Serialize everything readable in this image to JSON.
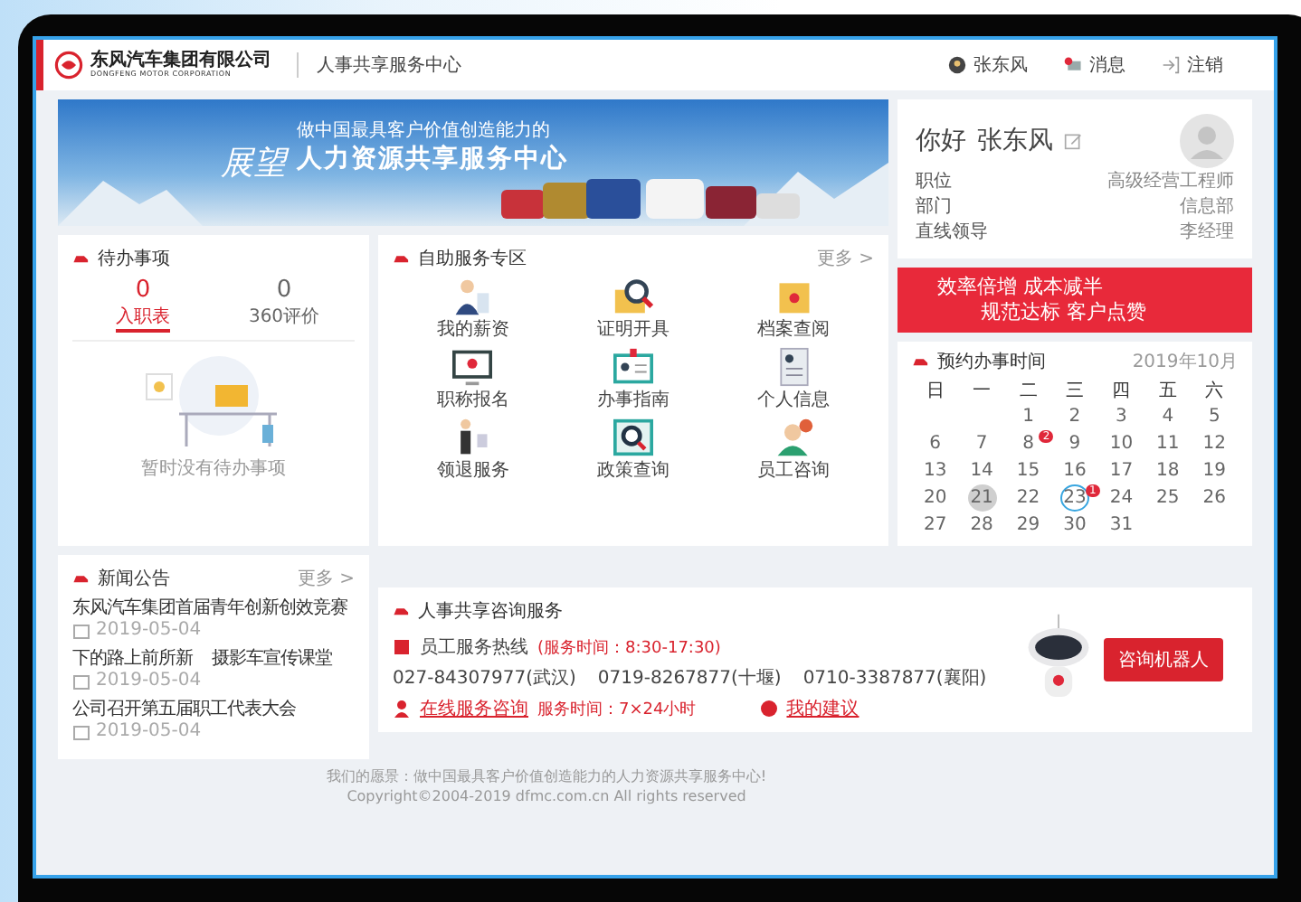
{
  "header": {
    "logo_name": "东风汽车集团有限公司",
    "logo_english": "DONGFENG MOTOR CORPORATION",
    "system_title": "人事共享服务中心",
    "user": "张东风",
    "messages": {
      "label": "消息",
      "unread": true
    },
    "logout": "注销"
  },
  "banner": {
    "calligraphy": "展望",
    "tagline": "做中国最具客户价值创造能力的",
    "title": "人力资源共享服务中心"
  },
  "todo": {
    "title": "待办事项",
    "tabs": [
      {
        "count": "0",
        "label": "入职表",
        "selected": true
      },
      {
        "count": "0",
        "label": "360评价",
        "selected": false
      }
    ],
    "empty_text": "暂时没有待办事项"
  },
  "services": {
    "title": "自助服务专区",
    "more": "更多 >",
    "items": [
      {
        "label": "我的薪资",
        "kind": "person-doc"
      },
      {
        "label": "证明开具",
        "kind": "folder-search"
      },
      {
        "label": "档案查阅",
        "kind": "folder"
      },
      {
        "label": "职称报名",
        "kind": "monitor"
      },
      {
        "label": "办事指南",
        "kind": "id-card"
      },
      {
        "label": "个人信息",
        "kind": "profile-doc"
      },
      {
        "label": "领退服务",
        "kind": "person-stand"
      },
      {
        "label": "政策查询",
        "kind": "window-search"
      },
      {
        "label": "员工咨询",
        "kind": "person-badge"
      }
    ]
  },
  "profile": {
    "greeting": "你好",
    "name": "张东风",
    "fields": [
      {
        "label": "职位",
        "value": "高级经营工程师"
      },
      {
        "label": "部门",
        "value": "信息部"
      },
      {
        "label": "直线领导",
        "value": "李经理"
      }
    ]
  },
  "promo": {
    "lines": [
      "效率倍增  成本减半",
      "规范达标  客户点赞"
    ]
  },
  "calendar": {
    "title": "预约办事时间",
    "month": "2019年10月",
    "weekdays": [
      "日",
      "一",
      "二",
      "三",
      "四",
      "五",
      "六"
    ],
    "weeks": [
      [
        {
          "day": "1",
          "selected": false,
          "circled": false
        },
        {
          "day": "2",
          "selected": false,
          "circled": false
        },
        {
          "day": "3",
          "selected": false,
          "circled": false
        },
        {
          "day": "4",
          "selected": false,
          "circled": false
        },
        {
          "day": "5",
          "selected": false,
          "circled": false
        }
      ],
      [
        {
          "day": "6",
          "selected": false,
          "circled": false
        },
        {
          "day": "7",
          "selected": false,
          "circled": false
        },
        {
          "day": "8",
          "selected": false,
          "circled": false,
          "badge": "2"
        },
        {
          "day": "9",
          "selected": false,
          "circled": false
        },
        {
          "day": "10",
          "selected": false,
          "circled": false
        },
        {
          "day": "11",
          "selected": false,
          "circled": false
        },
        {
          "day": "12",
          "selected": false,
          "circled": false
        }
      ],
      [
        {
          "day": "13",
          "selected": false,
          "circled": false
        },
        {
          "day": "14",
          "selected": false,
          "circled": false
        },
        {
          "day": "15",
          "selected": false,
          "circled": false
        },
        {
          "day": "16",
          "selected": false,
          "circled": false
        },
        {
          "day": "17",
          "selected": false,
          "circled": false
        },
        {
          "day": "18",
          "selected": false,
          "circled": false
        },
        {
          "day": "19",
          "selected": false,
          "circled": false
        }
      ],
      [
        {
          "day": "20",
          "selected": false,
          "circled": false
        },
        {
          "day": "21",
          "selected": true,
          "circled": false
        },
        {
          "day": "22",
          "selected": false,
          "circled": false
        },
        {
          "day": "23",
          "selected": false,
          "circled": true,
          "badge": "1"
        },
        {
          "day": "24",
          "selected": false,
          "circled": false
        },
        {
          "day": "25",
          "selected": false,
          "circled": false
        },
        {
          "day": "26",
          "selected": false,
          "circled": false
        }
      ],
      [
        {
          "day": "27",
          "selected": false,
          "circled": false
        },
        {
          "day": "28",
          "selected": false,
          "circled": false
        },
        {
          "day": "29",
          "selected": false,
          "circled": false
        },
        {
          "day": "30",
          "selected": false,
          "circled": false
        },
        {
          "day": "31",
          "selected": false,
          "circled": false
        }
      ]
    ]
  },
  "news": {
    "title": "新闻公告",
    "more": "更多 >",
    "items": [
      {
        "title": "东风汽车集团首届青年创新创效竞赛",
        "date": "2019-05-04"
      },
      {
        "title": "下的路上前所新    摄影车宣传课堂",
        "date": "2019-05-04"
      },
      {
        "title": "公司召开第五届职工代表大会",
        "date": "2019-05-04"
      }
    ]
  },
  "consult": {
    "title": "人事共享咨询服务",
    "hotline": {
      "label": "员工服务热线",
      "hours": "(服务时间：8:30-17:30)"
    },
    "phones": [
      "027-84307977(武汉)",
      "0719-8267877(十堰)",
      "0710-3387877(襄阳)"
    ],
    "online": {
      "label": "在线服务咨询",
      "hours": "服务时间：7×24小时"
    },
    "suggestion": "我的建议",
    "robot_button": "咨询机器人"
  },
  "footer": {
    "vision": "我们的愿景：做中国最具客户价值创造能力的人力资源共享服务中心!",
    "copyright": "Copyright©2004-2019 dfmc.com.cn All rights reserved"
  }
}
